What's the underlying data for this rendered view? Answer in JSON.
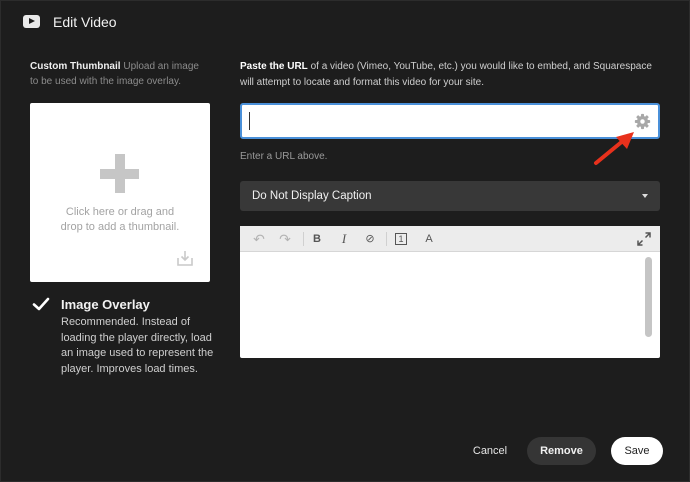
{
  "dialog": {
    "title": "Edit Video",
    "icon": "youtube-icon"
  },
  "thumbnail": {
    "heading": "Custom Thumbnail",
    "description": " Upload an image to be used with the image overlay.",
    "dropzone_text": "Click here or drag and drop to add a thumbnail."
  },
  "overlay": {
    "checked": true,
    "title": "Image Overlay",
    "description": "Recommended. Instead of loading the player directly, load an image used to represent the player. Improves load times."
  },
  "url_section": {
    "intro_bold": "Paste the URL",
    "intro_rest": " of a video (Vimeo, YouTube, etc.) you would like to embed, and Squarespace will attempt to locate and format this video for your site.",
    "input_value": "",
    "hint": "Enter a URL above."
  },
  "caption": {
    "selected": "Do Not Display Caption"
  },
  "editor": {
    "toolbar": {
      "undo": "↶",
      "redo": "↷",
      "bold": "B",
      "italic": "I",
      "link": "⊘",
      "code": "1",
      "clear": "A"
    },
    "content": ""
  },
  "buttons": {
    "cancel": "Cancel",
    "remove": "Remove",
    "save": "Save"
  },
  "colors": {
    "accent": "#4a90d9",
    "annotation_arrow": "#e8311c"
  }
}
